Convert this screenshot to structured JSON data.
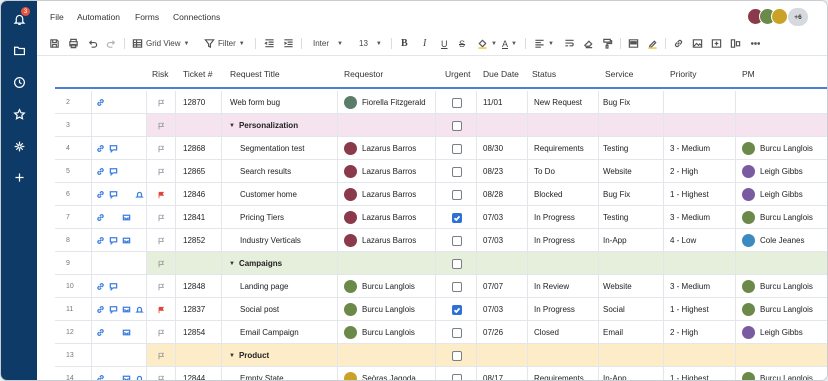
{
  "nav": {
    "notification_count": "3",
    "items": [
      "bell-icon",
      "folder-icon",
      "clock-icon",
      "star-icon",
      "hub-icon",
      "plus-icon"
    ]
  },
  "menubar": {
    "items": [
      "File",
      "Automation",
      "Forms",
      "Connections"
    ],
    "collaborators_more": "+6"
  },
  "toolbar": {
    "view_label": "Grid View",
    "filter_label": "Filter",
    "font": "Inter",
    "font_size": "13",
    "bold": "B",
    "italic": "I",
    "underline": "U",
    "strike": "S",
    "text_color": "A"
  },
  "columns": [
    "Risk",
    "Ticket #",
    "Request Title",
    "Requestor",
    "Urgent",
    "Due Date",
    "Status",
    "Service",
    "Priority",
    "PM"
  ],
  "group_colors": {
    "Personalization": "#f5e3ef",
    "Campaigns": "#e6efdc",
    "Product": "#fdecc8"
  },
  "rows": [
    {
      "num": "2",
      "kind": "row",
      "icons": [
        "link"
      ],
      "flag": "gray",
      "ticket": "12870",
      "title": "Web form bug",
      "indent": false,
      "requestor": "Fiorella Fitzgerald",
      "req_color": "#5a7d6a",
      "urgent": false,
      "due": "11/01",
      "status": "New Request",
      "service": "Bug Fix",
      "priority": "",
      "pm": "",
      "pm_color": ""
    },
    {
      "num": "3",
      "kind": "group",
      "group": "Personalization",
      "title": "Personalization"
    },
    {
      "num": "4",
      "kind": "row",
      "icons": [
        "link",
        "comment"
      ],
      "flag": "gray",
      "ticket": "12868",
      "title": "Segmentation test",
      "indent": true,
      "requestor": "Lazarus Barros",
      "req_color": "#8a3a4a",
      "urgent": false,
      "due": "08/30",
      "status": "Requirements",
      "service": "Testing",
      "priority": "3 - Medium",
      "pm": "Burcu Langlois",
      "pm_color": "#6b8a4a"
    },
    {
      "num": "5",
      "kind": "row",
      "icons": [
        "link",
        "comment"
      ],
      "flag": "gray",
      "ticket": "12865",
      "title": "Search results",
      "indent": true,
      "requestor": "Lazarus Barros",
      "req_color": "#8a3a4a",
      "urgent": false,
      "due": "08/23",
      "status": "To Do",
      "service": "Website",
      "priority": "2 - High",
      "pm": "Leigh Gibbs",
      "pm_color": "#7a5aa0"
    },
    {
      "num": "6",
      "kind": "row",
      "icons": [
        "link",
        "comment",
        "",
        "bell"
      ],
      "flag": "red",
      "ticket": "12846",
      "title": "Customer home",
      "indent": true,
      "requestor": "Lazarus Barros",
      "req_color": "#8a3a4a",
      "urgent": false,
      "due": "08/28",
      "status": "Blocked",
      "service": "Bug Fix",
      "priority": "1 - Highest",
      "pm": "Leigh Gibbs",
      "pm_color": "#7a5aa0"
    },
    {
      "num": "7",
      "kind": "row",
      "icons": [
        "link",
        "",
        "inbox"
      ],
      "flag": "gray",
      "ticket": "12841",
      "title": "Pricing Tiers",
      "indent": true,
      "requestor": "Lazarus Barros",
      "req_color": "#8a3a4a",
      "urgent": true,
      "due": "07/03",
      "status": "In Progress",
      "service": "Testing",
      "priority": "3 - Medium",
      "pm": "Burcu Langlois",
      "pm_color": "#6b8a4a"
    },
    {
      "num": "8",
      "kind": "row",
      "icons": [
        "link",
        "comment",
        "inbox"
      ],
      "flag": "gray",
      "ticket": "12852",
      "title": "Industry Verticals",
      "indent": true,
      "requestor": "Lazarus Barros",
      "req_color": "#8a3a4a",
      "urgent": false,
      "due": "07/03",
      "status": "In Progress",
      "service": "In-App",
      "priority": "4 - Low",
      "pm": "Cole Jeanes",
      "pm_color": "#3d8ac0"
    },
    {
      "num": "9",
      "kind": "group",
      "group": "Campaigns",
      "title": "Campaigns"
    },
    {
      "num": "10",
      "kind": "row",
      "icons": [
        "link",
        "comment"
      ],
      "flag": "gray",
      "ticket": "12848",
      "title": "Landing page",
      "indent": true,
      "requestor": "Burcu Langlois",
      "req_color": "#6b8a4a",
      "urgent": false,
      "due": "07/07",
      "status": "In Review",
      "service": "Website",
      "priority": "3 - Medium",
      "pm": "Burcu Langlois",
      "pm_color": "#6b8a4a"
    },
    {
      "num": "11",
      "kind": "row",
      "icons": [
        "link",
        "comment",
        "inbox",
        "bell"
      ],
      "flag": "red",
      "ticket": "12837",
      "title": "Social post",
      "indent": true,
      "requestor": "Burcu Langlois",
      "req_color": "#6b8a4a",
      "urgent": true,
      "due": "07/03",
      "status": "In Progress",
      "service": "Social",
      "priority": "1 - Highest",
      "pm": "Burcu Langlois",
      "pm_color": "#6b8a4a"
    },
    {
      "num": "12",
      "kind": "row",
      "icons": [
        "link",
        "",
        "inbox"
      ],
      "flag": "gray",
      "ticket": "12854",
      "title": "Email Campaign",
      "indent": true,
      "requestor": "Burcu Langlois",
      "req_color": "#6b8a4a",
      "urgent": false,
      "due": "07/26",
      "status": "Closed",
      "service": "Email",
      "priority": "2 - High",
      "pm": "Leigh Gibbs",
      "pm_color": "#7a5aa0"
    },
    {
      "num": "13",
      "kind": "group",
      "group": "Product",
      "title": "Product"
    },
    {
      "num": "14",
      "kind": "row",
      "icons": [
        "link",
        "",
        "inbox",
        "bell"
      ],
      "flag": "gray",
      "ticket": "12844",
      "title": "Empty State",
      "indent": true,
      "requestor": "Seòras Jagoda",
      "req_color": "#c9a227",
      "urgent": false,
      "due": "08/17",
      "status": "Requirements",
      "service": "In-App",
      "priority": "1 - Highest",
      "pm": "Burcu Langlois",
      "pm_color": "#6b8a4a"
    }
  ],
  "colors": {
    "nav_bg": "#0d3a66",
    "header_rule": "#4a7fd4",
    "checkbox_on": "#2f6fd6",
    "flag_red": "#e0463a"
  }
}
